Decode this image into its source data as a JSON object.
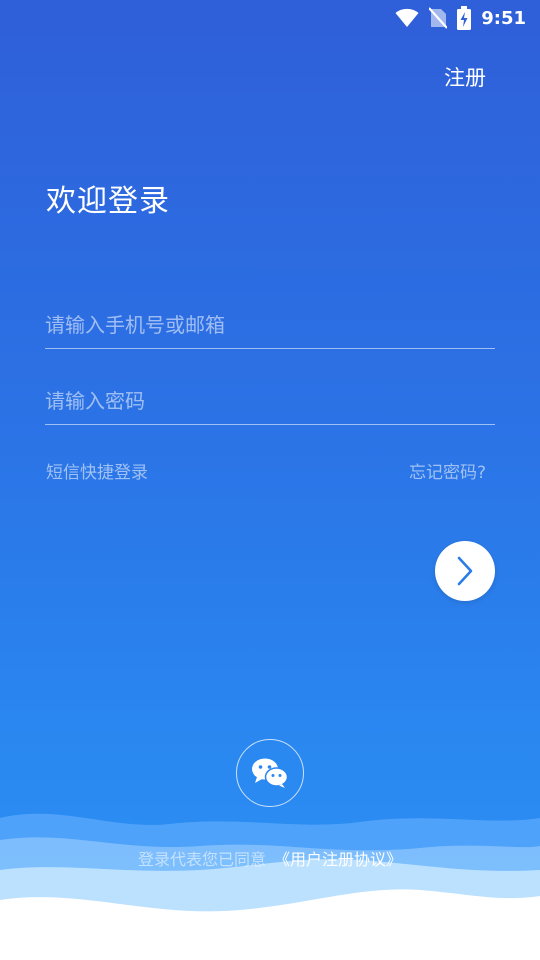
{
  "status_bar": {
    "time": "9:51",
    "icons": [
      "wifi-icon",
      "no-sim-icon",
      "battery-charging-icon"
    ]
  },
  "header": {
    "register_label": "注册"
  },
  "title": "欢迎登录",
  "form": {
    "phone_placeholder": "请输入手机号或邮箱",
    "phone_value": "",
    "password_placeholder": "请输入密码",
    "password_value": ""
  },
  "links": {
    "sms_login": "短信快捷登录",
    "forgot_password": "忘记密码?"
  },
  "buttons": {
    "submit_icon": "chevron-right-icon",
    "wechat_icon": "wechat-icon"
  },
  "agreement": {
    "prefix": "登录代表您已同意",
    "link": "《用户注册协议》"
  },
  "colors": {
    "gradient_top": "#2f5fd9",
    "gradient_bottom": "#2c93f4",
    "accent": "#2a7de8"
  }
}
